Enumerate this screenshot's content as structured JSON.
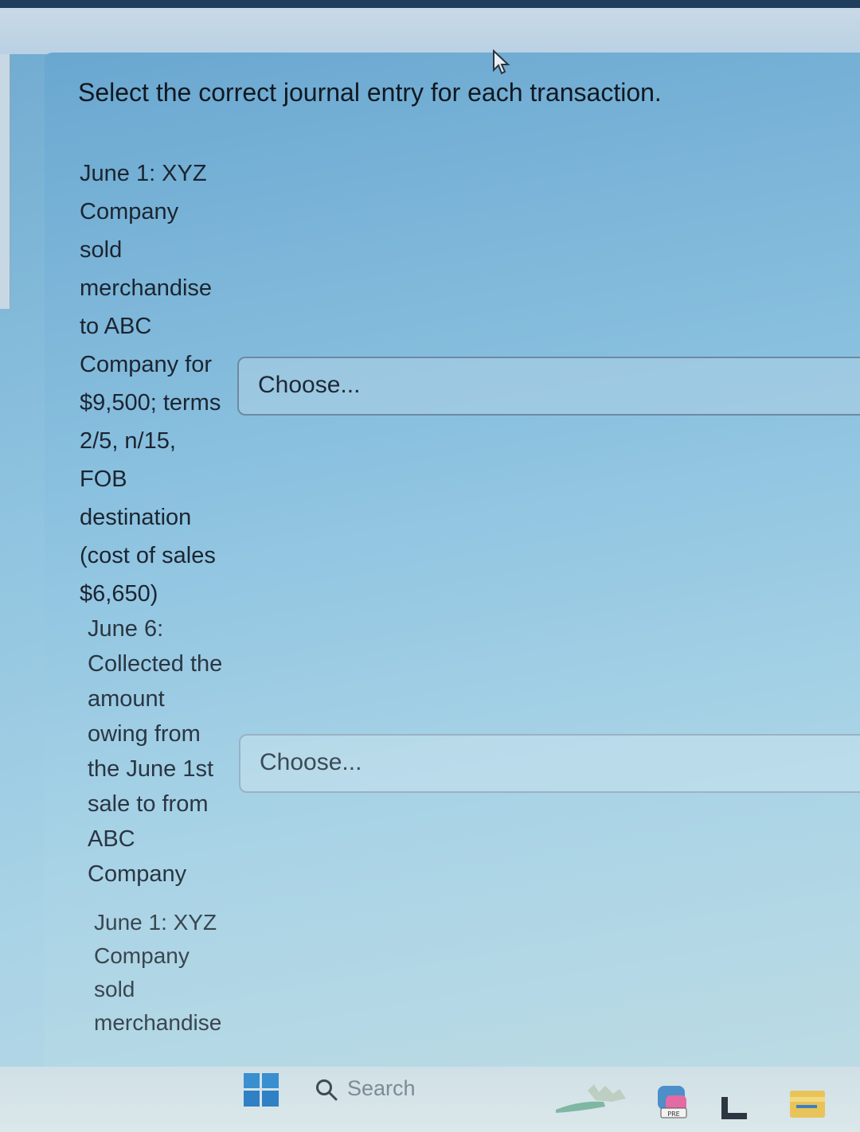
{
  "instruction": "Select the correct journal entry for each transaction.",
  "questions": [
    {
      "text": "June 1: XYZ\nCompany\nsold\nmerchandise\nto ABC\nCompany for\n$9,500; terms\n2/5, n/15,\nFOB\ndestination\n(cost of sales\n$6,650)",
      "select_value": "Choose..."
    },
    {
      "text": "June 6:\nCollected the\namount\nowing from\nthe June 1st\nsale to from\nABC\nCompany",
      "select_value": "Choose..."
    },
    {
      "text": "June 1: XYZ\nCompany\nsold\nmerchandise"
    }
  ],
  "taskbar": {
    "search_placeholder": "Search",
    "icons": [
      "windows-start-icon",
      "search-icon",
      "widget-icon",
      "copilot-icon",
      "app-icon",
      "file-explorer-icon"
    ]
  },
  "colors": {
    "accent_blue": "#6aa7d0",
    "text_dark": "#1b2530"
  }
}
